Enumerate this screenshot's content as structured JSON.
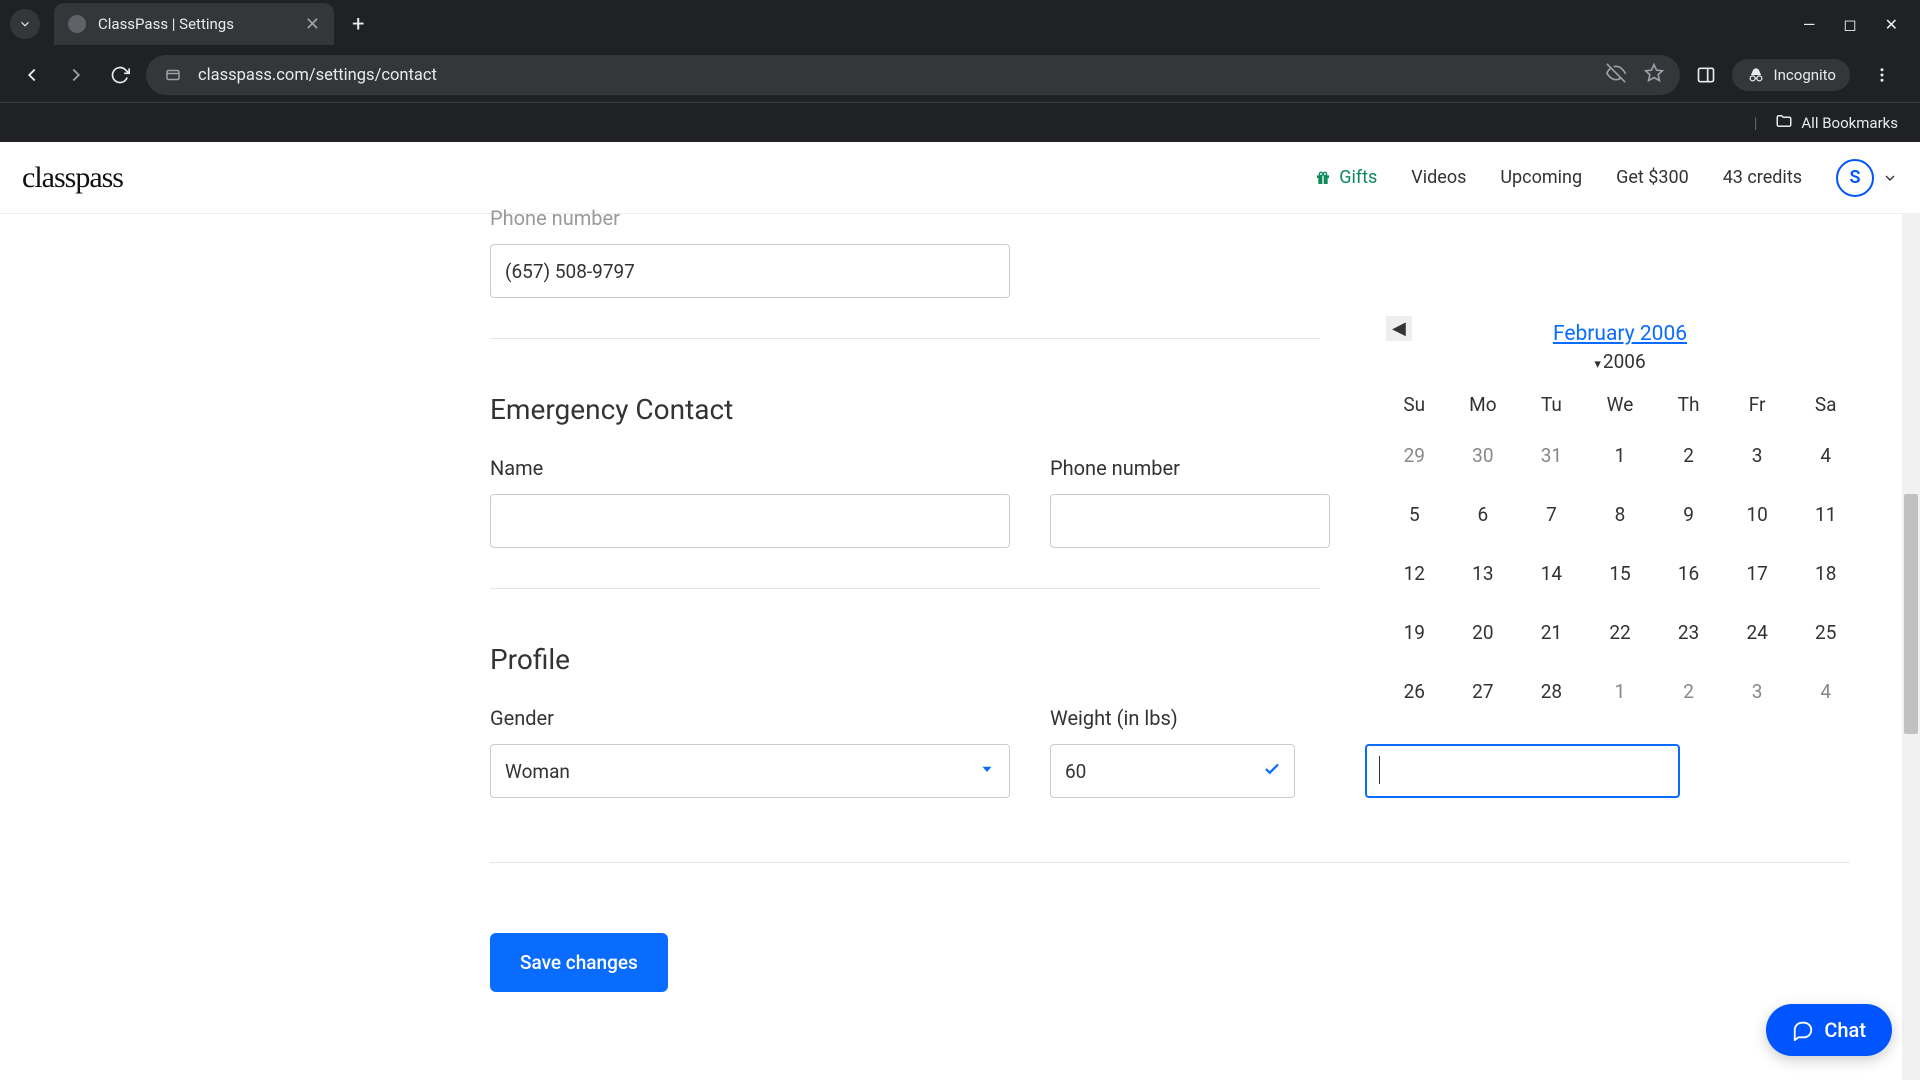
{
  "browser": {
    "tab_title": "ClassPass | Settings",
    "url": "classpass.com/settings/contact",
    "incognito_label": "Incognito",
    "all_bookmarks": "All Bookmarks"
  },
  "header": {
    "logo": "classpass",
    "gifts": "Gifts",
    "videos": "Videos",
    "upcoming": "Upcoming",
    "referral": "Get $300",
    "credits": "43 credits",
    "avatar_initial": "S"
  },
  "form": {
    "phone_label": "Phone number",
    "phone_value": "(657) 508-9797",
    "emergency_title": "Emergency Contact",
    "emergency_name_label": "Name",
    "emergency_name_value": "",
    "emergency_phone_label": "Phone number",
    "emergency_phone_value": "",
    "profile_title": "Profile",
    "gender_label": "Gender",
    "gender_value": "Woman",
    "weight_label": "Weight (in lbs)",
    "weight_value": "60",
    "date_value": "",
    "save_button": "Save changes"
  },
  "calendar": {
    "title": "February 2006",
    "year": "2006",
    "dow": [
      "Su",
      "Mo",
      "Tu",
      "We",
      "Th",
      "Fr",
      "Sa"
    ],
    "days": [
      {
        "d": "29",
        "m": true
      },
      {
        "d": "30",
        "m": true
      },
      {
        "d": "31",
        "m": true
      },
      {
        "d": "1"
      },
      {
        "d": "2"
      },
      {
        "d": "3"
      },
      {
        "d": "4"
      },
      {
        "d": "5"
      },
      {
        "d": "6"
      },
      {
        "d": "7"
      },
      {
        "d": "8"
      },
      {
        "d": "9"
      },
      {
        "d": "10"
      },
      {
        "d": "11"
      },
      {
        "d": "12"
      },
      {
        "d": "13"
      },
      {
        "d": "14"
      },
      {
        "d": "15"
      },
      {
        "d": "16"
      },
      {
        "d": "17"
      },
      {
        "d": "18"
      },
      {
        "d": "19"
      },
      {
        "d": "20"
      },
      {
        "d": "21"
      },
      {
        "d": "22"
      },
      {
        "d": "23"
      },
      {
        "d": "24"
      },
      {
        "d": "25"
      },
      {
        "d": "26"
      },
      {
        "d": "27"
      },
      {
        "d": "28"
      },
      {
        "d": "1",
        "m": true
      },
      {
        "d": "2",
        "m": true
      },
      {
        "d": "3",
        "m": true
      },
      {
        "d": "4",
        "m": true
      }
    ]
  },
  "chat": {
    "label": "Chat"
  }
}
